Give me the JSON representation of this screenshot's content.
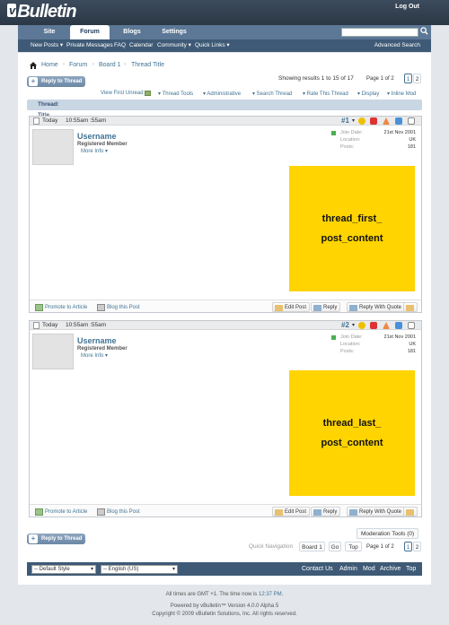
{
  "header": {
    "logo_text": "Bulletin",
    "logo_v": "v",
    "logout": "Log Out",
    "tabs": [
      {
        "label": "Site"
      },
      {
        "label": "Forum"
      },
      {
        "label": "Blogs"
      },
      {
        "label": "Settings"
      }
    ],
    "search_placeholder": ""
  },
  "subnav": {
    "items": [
      "New Posts ▾",
      "Private Messages",
      "FAQ",
      "Calendar",
      "Community ▾",
      "Quick Links ▾"
    ],
    "advanced_search": "Advanced Search"
  },
  "breadcrumb": [
    "Home",
    "Forum",
    "Board 1",
    "Thread Title"
  ],
  "reply_button": "Reply to Thread",
  "results_text": "Showing results 1 to 15 of 17",
  "page_of": "Page 1 of 2",
  "pages": [
    "1",
    "2"
  ],
  "tools": [
    "View First Unread",
    "▾ Thread Tools",
    "▾ Administrative",
    "▾ Search Thread",
    "▾ Rate This Thread",
    "▾ Display",
    "▾ Inline Mod"
  ],
  "thread_bar": {
    "prefix": "Thread:",
    "title": "Thread Title"
  },
  "posts": [
    {
      "date": "Today",
      "time": "10:55am :55am",
      "number": "#1",
      "username": "Username",
      "user_title": "Registered Member",
      "more_info": "More Info",
      "join_label": "Join Date:",
      "join_value": "21st Nov 2001",
      "location_label": "Location:",
      "location_value": "UK",
      "posts_label": "Posts:",
      "posts_value": "181",
      "content_line1": "thread_first_",
      "content_line2": "post_content",
      "promote": "Promote to Article",
      "blog": "Blog this Post",
      "edit": "Edit Post",
      "reply": "Reply",
      "quote": "Reply With Quote"
    },
    {
      "date": "Today",
      "time": "10:55am :55am",
      "number": "#2",
      "username": "Username",
      "user_title": "Registered Member",
      "more_info": "More Info",
      "join_label": "Join Date:",
      "join_value": "21st Nov 2001",
      "location_label": "Location:",
      "location_value": "UK",
      "posts_label": "Posts:",
      "posts_value": "181",
      "content_line1": "thread_last_",
      "content_line2": "post_content",
      "promote": "Promote to Article",
      "blog": "Blog this Post",
      "edit": "Edit Post",
      "reply": "Reply",
      "quote": "Reply With Quote"
    }
  ],
  "moderation_tools": "Moderation Tools (0)",
  "quick_nav": {
    "label": "Quick Navigation",
    "board": "Board 1",
    "go": "Go",
    "top": "Top"
  },
  "footer": {
    "style_select": "-- Default Style",
    "lang_select": "-- English (US)",
    "links": [
      "Contact Us",
      "Admin",
      "Mod",
      "Archive",
      "Top"
    ],
    "time_prefix": "All times are GMT +1. The time now is",
    "time_value": "12:37 PM",
    "powered": "Powered by vBulletin™ Version 4.0.0 Alpha 5",
    "copyright": "Copyright © 2009 vBulletin Solutions, Inc. All rights reserved."
  },
  "colors": {
    "accent": "#417394",
    "content_placeholder": "#ffd400",
    "header": "#2b3744"
  }
}
